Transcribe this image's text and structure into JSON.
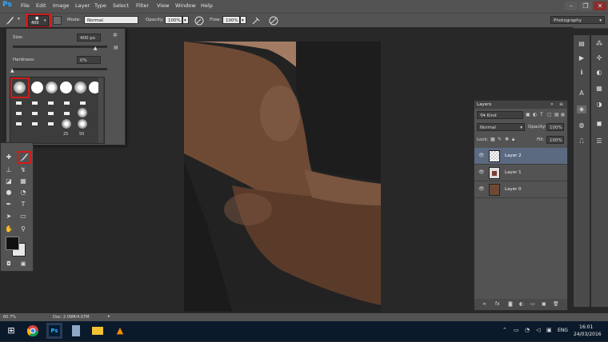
{
  "app": {
    "logo": "Ps"
  },
  "menu": [
    "File",
    "Edit",
    "Image",
    "Layer",
    "Type",
    "Select",
    "Filter",
    "View",
    "Window",
    "Help"
  ],
  "window_controls": {
    "minimize": "–",
    "restore": "❐",
    "close": "✕"
  },
  "options": {
    "brush_size": "400",
    "mode_label": "Mode:",
    "mode_value": "Normal",
    "opacity_label": "Opacity:",
    "opacity_value": "100%",
    "flow_label": "Flow:",
    "flow_value": "100%",
    "workspace": "Photography"
  },
  "brush_picker": {
    "size_label": "Size:",
    "size_value": "400 px",
    "size_percent": 0.88,
    "hardness_label": "Hardness:",
    "hardness_value": "0%",
    "hardness_percent": 0,
    "preset_labels": [
      "25",
      "50"
    ]
  },
  "layers_panel": {
    "title": "Layers",
    "filter_value": "Kind",
    "blend_mode": "Normal",
    "opacity_label": "Opacity:",
    "opacity_value": "100%",
    "lock_label": "Lock:",
    "fill_label": "Fill:",
    "fill_value": "100%",
    "layers": [
      {
        "name": "Layer 2",
        "selected": true
      },
      {
        "name": "Layer 1",
        "selected": false
      },
      {
        "name": "Layer 0",
        "selected": false
      }
    ],
    "footer_icons": [
      "link-icon",
      "fx-icon",
      "mask-icon",
      "adjustment-icon",
      "group-icon",
      "new-layer-icon",
      "trash-icon"
    ]
  },
  "status": {
    "zoom": "60.7%",
    "doc": "Doc: 2.09M/4.07M"
  },
  "taskbar": {
    "lang": "ENG",
    "time": "16:01",
    "date": "24/03/2016"
  },
  "colors": {
    "accent": "#d01c1c",
    "selected_layer": "#5b6a80",
    "ps_blue": "#31a8ff"
  }
}
